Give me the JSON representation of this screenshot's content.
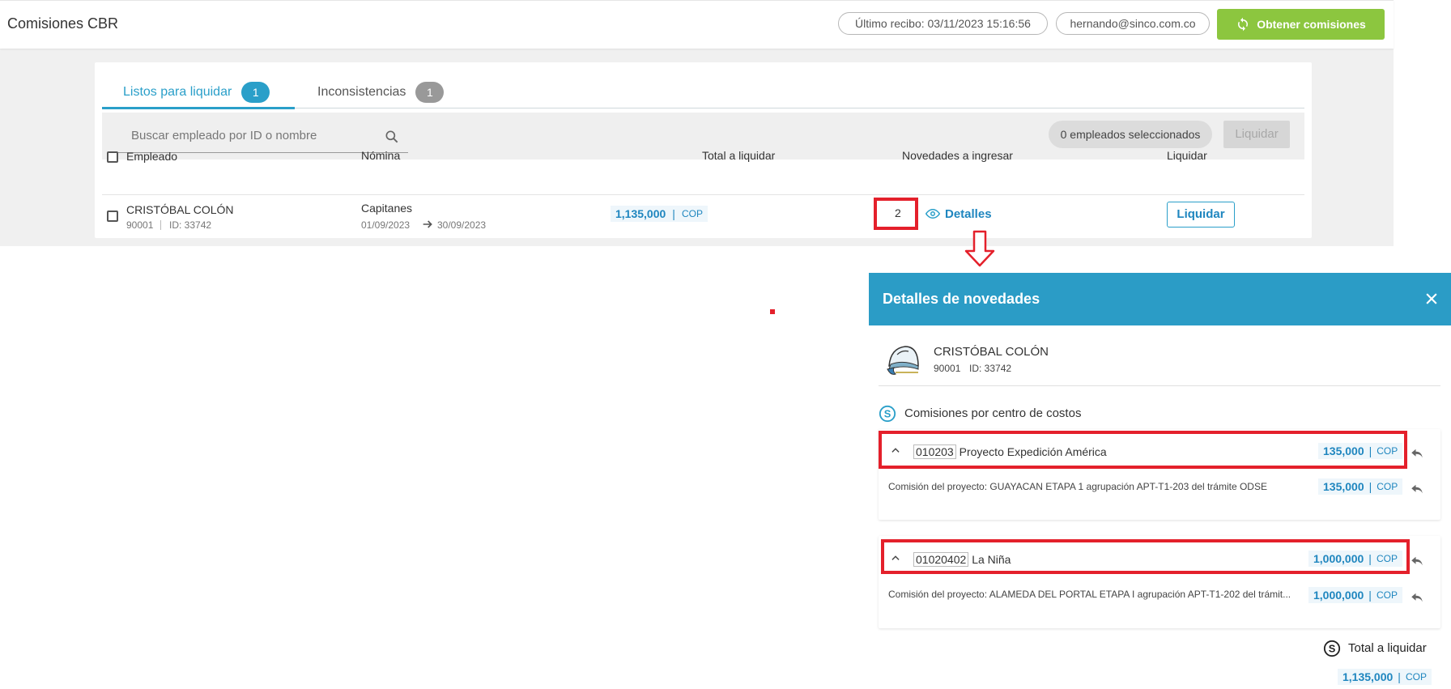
{
  "app": {
    "title": "Comisiones CBR",
    "last_receipt": "Último recibo: 03/11/2023 15:16:56",
    "user_email": "hernando@sinco.com.co",
    "get_commissions_label": "Obtener comisiones"
  },
  "tabs": [
    {
      "label": "Listos para liquidar",
      "count": "1",
      "active": true
    },
    {
      "label": "Inconsistencias",
      "count": "1",
      "active": false
    }
  ],
  "toolbar": {
    "search_placeholder": "Buscar empleado por ID o nombre",
    "selected_count": "0 empleados seleccionados",
    "liquidar_label": "Liquidar"
  },
  "table": {
    "headers": [
      "Empleado",
      "Nómina",
      "Total a liquidar",
      "Novedades a ingresar",
      "Liquidar"
    ],
    "rows": [
      {
        "name": "CRISTÓBAL COLÓN",
        "code": "90001",
        "id": "ID: 33742",
        "payroll": "Capitanes",
        "date_from": "01/09/2023",
        "date_to": "30/09/2023",
        "total": "1,135,000",
        "separator": "|",
        "currency": "COP",
        "novedades_count": "2",
        "details_label": "Detalles",
        "liquidar_label": "Liquidar"
      }
    ]
  },
  "panel": {
    "title": "Detalles de novedades",
    "employee_name": "CRISTÓBAL COLÓN",
    "employee_code": "90001",
    "employee_id": "ID: 33742",
    "section_title": "Comisiones por centro de costos",
    "cost_centers": [
      {
        "code": "010203",
        "name": "Proyecto Expedición América",
        "amount": "135,000",
        "currency": "COP",
        "detail_text": "Comisión del proyecto: GUAYACAN ETAPA 1 agrupación APT-T1-203 del trámite ODSE",
        "detail_amount": "135,000",
        "detail_currency": "COP"
      },
      {
        "code": "01020402",
        "name": "La Niña",
        "amount": "1,000,000",
        "currency": "COP",
        "detail_text": "Comisión del proyecto: ALAMEDA DEL PORTAL ETAPA I agrupación APT-T1-202 del trámit...",
        "detail_amount": "1,000,000",
        "detail_currency": "COP"
      }
    ],
    "total_label": "Total a liquidar",
    "total_amount": "1,135,000",
    "total_currency": "COP"
  },
  "colors": {
    "accent": "#2a9fc9",
    "panel_header": "#2b9cc6",
    "green_button": "#8cc63f",
    "highlight": "#e4202b",
    "money_text": "#1f86bf"
  },
  "icons": [
    "refresh-icon",
    "search-icon",
    "arrow-right-icon",
    "eye-icon",
    "close-icon",
    "avatar-icon",
    "dollar-icon",
    "chevron-up-icon",
    "undo-icon",
    "down-arrow-icon"
  ]
}
